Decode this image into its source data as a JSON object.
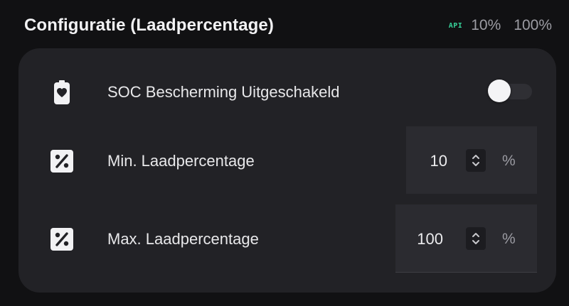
{
  "header": {
    "title": "Configuratie (Laadpercentage)",
    "api_badge": "API",
    "min_value": "10%",
    "max_value": "100%"
  },
  "settings": {
    "soc_protection": {
      "label": "SOC Bescherming Uitgeschakeld",
      "icon": "battery-heart-icon",
      "enabled": false
    },
    "min_charge": {
      "label": "Min. Laadpercentage",
      "icon": "percent-icon",
      "value": "10",
      "unit": "%"
    },
    "max_charge": {
      "label": "Max. Laadpercentage",
      "icon": "percent-icon",
      "value": "100",
      "unit": "%"
    }
  },
  "colors": {
    "background": "#111113",
    "card": "#222226",
    "accent_api": "#37d29a",
    "input_bg": "#2b2b30"
  }
}
